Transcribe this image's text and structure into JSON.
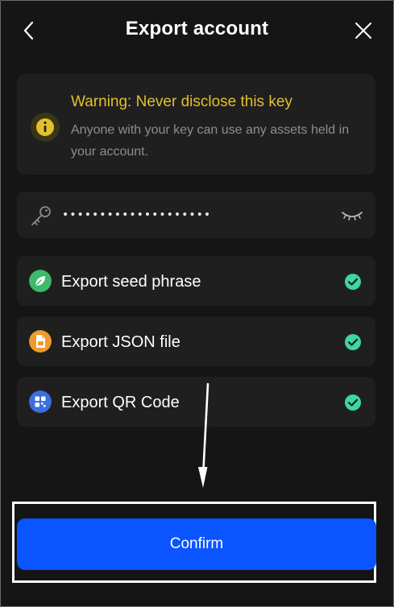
{
  "header": {
    "title": "Export account"
  },
  "warning": {
    "title": "Warning: Never disclose this key",
    "text": "Anyone with your key can use any assets held in your account."
  },
  "key_field": {
    "value": "••••••••••••••••••••"
  },
  "options": [
    {
      "label": "Export seed phrase",
      "icon": "leaf-icon",
      "color": "#3dba6b",
      "checked": true
    },
    {
      "label": "Export JSON file",
      "icon": "json-file-icon",
      "color": "#f09a2c",
      "checked": true
    },
    {
      "label": "Export QR Code",
      "icon": "qr-code-icon",
      "color": "#3b6fe0",
      "checked": true
    }
  ],
  "confirm": {
    "label": "Confirm"
  },
  "colors": {
    "accent": "#0a55ff",
    "warning": "#e2c02b",
    "check": "#3ed6a3"
  }
}
